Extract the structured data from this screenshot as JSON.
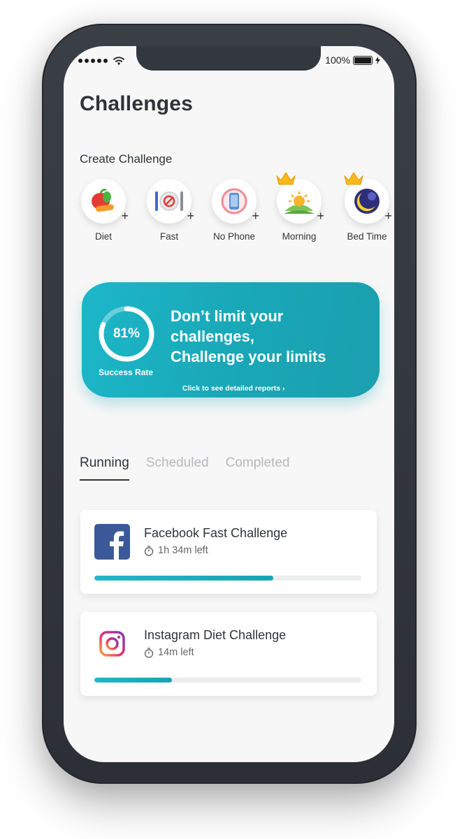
{
  "status": {
    "battery": "100%"
  },
  "page": {
    "title": "Challenges",
    "create_label": "Create Challenge"
  },
  "categories": [
    {
      "label": "Diet",
      "icon": "apple-carrot-icon",
      "crown": false
    },
    {
      "label": "Fast",
      "icon": "plate-cutlery-icon",
      "crown": false
    },
    {
      "label": "No Phone",
      "icon": "no-phone-icon",
      "crown": false
    },
    {
      "label": "Morning",
      "icon": "sunrise-icon",
      "crown": true
    },
    {
      "label": "Bed Time",
      "icon": "moon-icon",
      "crown": true
    }
  ],
  "banner": {
    "rate": "81%",
    "rate_value": 0.81,
    "rate_label": "Success Rate",
    "line1": "Don’t limit your",
    "line2": "challenges,",
    "line3": "Challenge your limits",
    "link": "Click to see detailed reports ›"
  },
  "tabs": [
    "Running",
    "Scheduled",
    "Completed"
  ],
  "challenges": [
    {
      "title": "Facebook Fast Challenge",
      "time": "1h 34m left",
      "icon": "facebook-icon",
      "progress": 0.67
    },
    {
      "title": "Instagram Diet Challenge",
      "time": "14m left",
      "icon": "instagram-icon",
      "progress": 0.29
    }
  ],
  "colors": {
    "accent": "#1cb7c9",
    "text": "#2f3338",
    "muted": "#b7b9bc",
    "facebook": "#3b5998"
  }
}
